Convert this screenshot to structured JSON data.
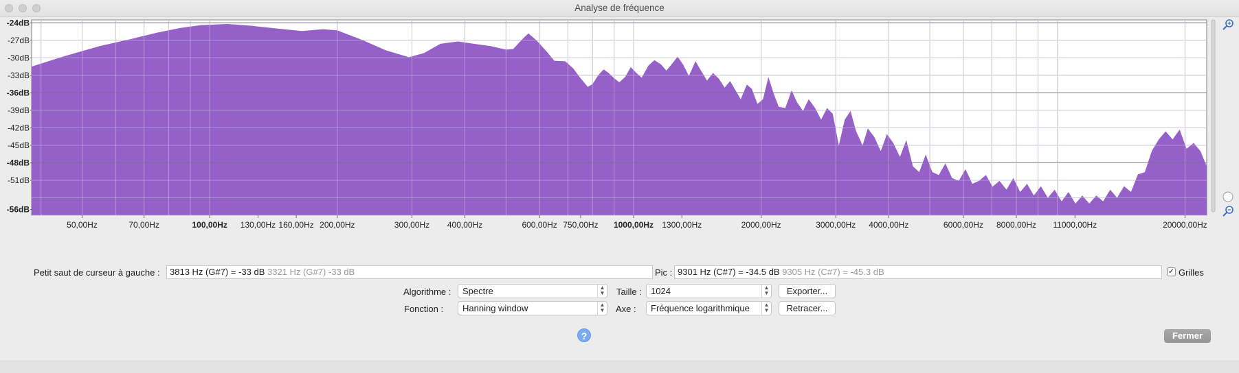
{
  "window": {
    "title": "Analyse de fréquence"
  },
  "chart_data": {
    "type": "area",
    "color": "#9560c8",
    "xscale": "log",
    "xlim": [
      38,
      22500
    ],
    "ylim": [
      -57,
      -23.5
    ],
    "grid": true,
    "y_ticks": [
      "-24dB",
      "-27dB",
      "-30dB",
      "-33dB",
      "-36dB",
      "-39dB",
      "-42dB",
      "-45dB",
      "-48dB",
      "-51dB",
      "-56dB"
    ],
    "y_tick_values": [
      -24,
      -27,
      -30,
      -33,
      -36,
      -39,
      -42,
      -45,
      -48,
      -51,
      -56
    ],
    "y_bold": [
      "-24dB",
      "-36dB",
      "-48dB",
      "-56dB"
    ],
    "x_ticks": [
      "50,00Hz",
      "70,00Hz",
      "100,00Hz",
      "130,00Hz",
      "160,00Hz",
      "200,00Hz",
      "300,00Hz",
      "400,00Hz",
      "600,00Hz",
      "750,00Hz",
      "1000,00Hz",
      "1300,00Hz",
      "2000,00Hz",
      "3000,00Hz",
      "4000,00Hz",
      "6000,00Hz",
      "8000,00Hz",
      "11000,00Hz",
      "20000,00Hz"
    ],
    "x_tick_values": [
      50,
      70,
      100,
      130,
      160,
      200,
      300,
      400,
      600,
      750,
      1000,
      1300,
      2000,
      3000,
      4000,
      6000,
      8000,
      11000,
      20000
    ],
    "x_bold": [
      "100,00Hz",
      "1000,00Hz"
    ],
    "envelope": [
      [
        38,
        -31.5
      ],
      [
        45,
        -29.8
      ],
      [
        55,
        -28.0
      ],
      [
        65,
        -26.8
      ],
      [
        75,
        -25.7
      ],
      [
        85,
        -24.9
      ],
      [
        95,
        -24.4
      ],
      [
        110,
        -24.2
      ],
      [
        125,
        -24.5
      ],
      [
        145,
        -25.0
      ],
      [
        165,
        -25.4
      ],
      [
        185,
        -25.1
      ],
      [
        200,
        -25.3
      ],
      [
        230,
        -27.0
      ],
      [
        260,
        -28.7
      ],
      [
        295,
        -29.9
      ],
      [
        320,
        -29.2
      ],
      [
        350,
        -27.6
      ],
      [
        385,
        -27.2
      ],
      [
        420,
        -27.6
      ],
      [
        460,
        -28.0
      ],
      [
        500,
        -28.6
      ],
      [
        520,
        -28.5
      ],
      [
        545,
        -26.9
      ],
      [
        565,
        -25.8
      ],
      [
        590,
        -27.0
      ],
      [
        625,
        -29.0
      ],
      [
        650,
        -30.5
      ],
      [
        690,
        -30.6
      ],
      [
        720,
        -31.8
      ],
      [
        750,
        -33.5
      ],
      [
        780,
        -35.0
      ],
      [
        800,
        -34.5
      ],
      [
        825,
        -33.0
      ],
      [
        850,
        -32.0
      ],
      [
        870,
        -32.5
      ],
      [
        900,
        -33.5
      ],
      [
        925,
        -34.2
      ],
      [
        955,
        -33.3
      ],
      [
        985,
        -31.6
      ],
      [
        1015,
        -32.6
      ],
      [
        1045,
        -33.4
      ],
      [
        1085,
        -31.3
      ],
      [
        1120,
        -30.4
      ],
      [
        1160,
        -31.1
      ],
      [
        1195,
        -32.2
      ],
      [
        1230,
        -31.1
      ],
      [
        1270,
        -29.8
      ],
      [
        1310,
        -31.2
      ],
      [
        1350,
        -33.1
      ],
      [
        1400,
        -30.6
      ],
      [
        1440,
        -32.1
      ],
      [
        1490,
        -33.9
      ],
      [
        1540,
        -32.6
      ],
      [
        1590,
        -33.6
      ],
      [
        1640,
        -35.1
      ],
      [
        1690,
        -34.0
      ],
      [
        1740,
        -35.6
      ],
      [
        1790,
        -37.1
      ],
      [
        1850,
        -34.6
      ],
      [
        1900,
        -35.3
      ],
      [
        1960,
        -37.9
      ],
      [
        2020,
        -37.1
      ],
      [
        2080,
        -33.3
      ],
      [
        2140,
        -36.1
      ],
      [
        2200,
        -38.4
      ],
      [
        2280,
        -38.6
      ],
      [
        2360,
        -35.6
      ],
      [
        2430,
        -37.6
      ],
      [
        2510,
        -39.1
      ],
      [
        2590,
        -37.1
      ],
      [
        2680,
        -38.6
      ],
      [
        2770,
        -40.6
      ],
      [
        2860,
        -38.6
      ],
      [
        2950,
        -39.6
      ],
      [
        3050,
        -45.0
      ],
      [
        3150,
        -40.6
      ],
      [
        3250,
        -39.1
      ],
      [
        3350,
        -42.6
      ],
      [
        3470,
        -45.0
      ],
      [
        3570,
        -42.1
      ],
      [
        3700,
        -43.6
      ],
      [
        3830,
        -46.0
      ],
      [
        3960,
        -43.1
      ],
      [
        4100,
        -44.6
      ],
      [
        4250,
        -47.0
      ],
      [
        4400,
        -44.1
      ],
      [
        4560,
        -48.6
      ],
      [
        4720,
        -49.6
      ],
      [
        4890,
        -46.6
      ],
      [
        5070,
        -49.6
      ],
      [
        5250,
        -50.1
      ],
      [
        5440,
        -48.1
      ],
      [
        5640,
        -50.6
      ],
      [
        5850,
        -51.1
      ],
      [
        6070,
        -49.1
      ],
      [
        6300,
        -51.6
      ],
      [
        6530,
        -51.1
      ],
      [
        6780,
        -50.1
      ],
      [
        7030,
        -52.1
      ],
      [
        7300,
        -51.1
      ],
      [
        7580,
        -52.6
      ],
      [
        7870,
        -50.6
      ],
      [
        8170,
        -53.0
      ],
      [
        8480,
        -51.6
      ],
      [
        8800,
        -53.6
      ],
      [
        9140,
        -52.0
      ],
      [
        9490,
        -54.0
      ],
      [
        9850,
        -52.6
      ],
      [
        10230,
        -54.6
      ],
      [
        10620,
        -53.0
      ],
      [
        11030,
        -55.0
      ],
      [
        11450,
        -53.6
      ],
      [
        11890,
        -55.0
      ],
      [
        12350,
        -53.6
      ],
      [
        12820,
        -54.6
      ],
      [
        13320,
        -52.6
      ],
      [
        13830,
        -54.0
      ],
      [
        14360,
        -52.0
      ],
      [
        14910,
        -53.0
      ],
      [
        15480,
        -50.0
      ],
      [
        16080,
        -49.6
      ],
      [
        16700,
        -46.0
      ],
      [
        17340,
        -44.0
      ],
      [
        18000,
        -42.6
      ],
      [
        18700,
        -44.0
      ],
      [
        19420,
        -42.3
      ],
      [
        20170,
        -45.6
      ],
      [
        20950,
        -44.6
      ],
      [
        21750,
        -46.0
      ],
      [
        22500,
        -48.6
      ]
    ]
  },
  "controls": {
    "cursor_label": "Petit saut de curseur à gauche :",
    "cursor_value": "3813 Hz (G#7) = -33 dB",
    "cursor_ghost": "3321 Hz (G#7) -33 dB",
    "peak_label": "Pic :",
    "peak_value": "9301 Hz (C#7) = -34.5 dB",
    "peak_ghost": "9305 Hz (C#7) = -45.3 dB",
    "grids_label": "Grilles",
    "grids_checked": "✓",
    "algorithm_label": "Algorithme :",
    "algorithm_value": "Spectre",
    "size_label": "Taille :",
    "size_value": "1024",
    "function_label": "Fonction :",
    "function_value": "Hanning window",
    "axis_label": "Axe :",
    "axis_value": "Fréquence logarithmique",
    "export_button": "Exporter...",
    "replot_button": "Retracer...",
    "help_button": "?",
    "close_button": "Fermer"
  }
}
